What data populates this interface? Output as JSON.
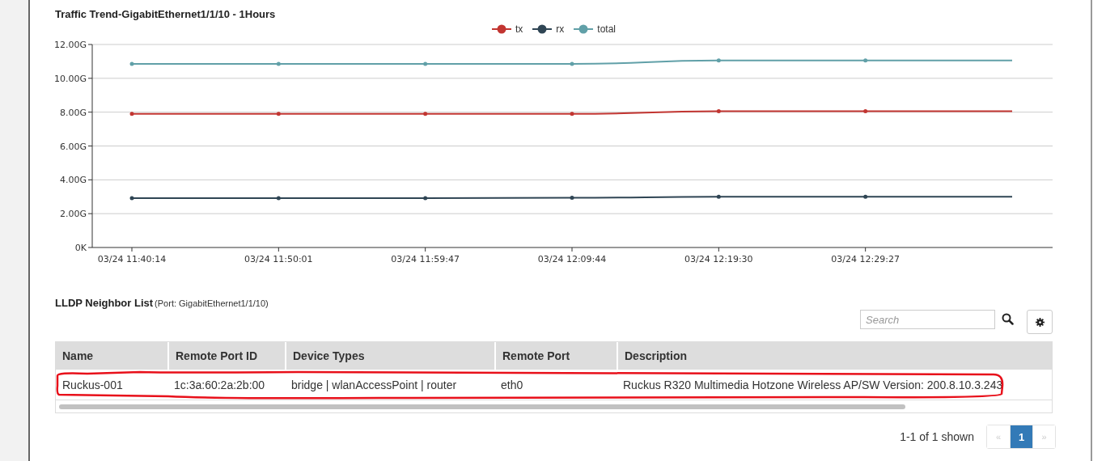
{
  "traffic_chart": {
    "title": "Traffic Trend-GigabitEthernet1/1/10 - 1Hours",
    "chart_data": {
      "type": "line",
      "grid": true,
      "categories": [
        "03/24 11:40:14",
        "03/24 11:50:01",
        "03/24 11:59:47",
        "03/24 12:09:44",
        "03/24 12:19:30",
        "03/24 12:29:27",
        null
      ],
      "ylim": [
        0,
        12
      ],
      "yticks": [
        {
          "value": 0,
          "label": "0K"
        },
        {
          "value": 2,
          "label": "2.00G"
        },
        {
          "value": 4,
          "label": "4.00G"
        },
        {
          "value": 6,
          "label": "6.00G"
        },
        {
          "value": 8,
          "label": "8.00G"
        },
        {
          "value": 10,
          "label": "10.00G"
        },
        {
          "value": 12,
          "label": "12.00G"
        }
      ],
      "series": [
        {
          "name": "tx",
          "color": "#c23531",
          "values": [
            7.9,
            7.9,
            7.9,
            7.9,
            8.05,
            8.05,
            8.05
          ]
        },
        {
          "name": "rx",
          "color": "#2f4554",
          "values": [
            2.92,
            2.92,
            2.92,
            2.94,
            3.0,
            3.0,
            3.0
          ]
        },
        {
          "name": "total",
          "color": "#61a0a8",
          "values": [
            10.85,
            10.85,
            10.85,
            10.85,
            11.05,
            11.05,
            11.05
          ]
        }
      ]
    }
  },
  "lldp": {
    "title": "LLDP Neighbor List",
    "subtitle": "(Port: GigabitEthernet1/1/10)",
    "search": {
      "placeholder": "Search"
    },
    "table": {
      "columns": [
        "Name",
        "Remote Port ID",
        "Device Types",
        "Remote Port",
        "Description"
      ],
      "rows": [
        {
          "highlighted": true,
          "cells": [
            "Ruckus-001",
            "1c:3a:60:2a:2b:00",
            "bridge | wlanAccessPoint | router",
            "eth0",
            "Ruckus R320 Multimedia Hotzone Wireless AP/SW Version: 200.8.10.3.243"
          ]
        }
      ]
    },
    "summary": "1-1 of 1 shown",
    "pagination": [
      {
        "label": "«",
        "kind": "prev",
        "disabled": true,
        "selected": false
      },
      {
        "label": "1",
        "kind": "page",
        "disabled": false,
        "selected": true
      },
      {
        "label": "»",
        "kind": "next",
        "disabled": true,
        "selected": false
      }
    ]
  }
}
